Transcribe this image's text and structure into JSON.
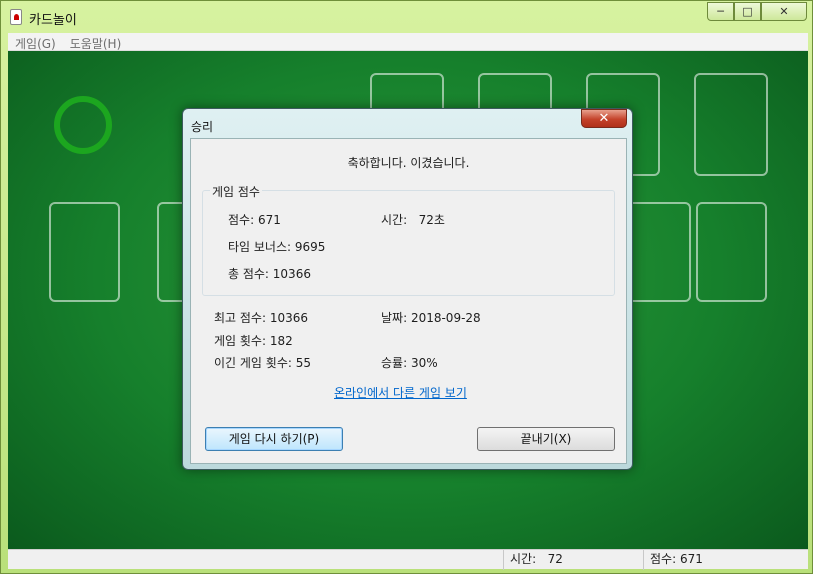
{
  "window": {
    "title": "카드놀이",
    "buttons": {
      "minimize": "─",
      "maximize": "□",
      "close": "✕"
    }
  },
  "menu": [
    "게임(G)",
    "도움말(H)"
  ],
  "statusbar": {
    "time_label": "시간:",
    "time_value": "72",
    "score_label": "점수:",
    "score_value": "671"
  },
  "dialog": {
    "title": "승리",
    "close_glyph": "✕",
    "congrats": "축하합니다. 이겼습니다.",
    "score_group": {
      "label": "게임 점수",
      "score": "점수: 671",
      "time": "시간:   72초",
      "time_bonus": "타임 보너스: 9695",
      "total": "총 점수: 10366"
    },
    "stats": {
      "best": "최고 점수: 10366",
      "date": "날짜: 2018-09-28",
      "played": "게임 횟수: 182",
      "won": "이긴 게임 횟수: 55",
      "win_rate": "승률: 30%"
    },
    "online_link": "온라인에서 다른 게임 보기",
    "play_again": "게임 다시 하기(P)",
    "exit": "끝내기(X)"
  },
  "colors": {
    "felt": "#16802c",
    "accent": "#3c7fb1",
    "link": "#0066cc"
  }
}
